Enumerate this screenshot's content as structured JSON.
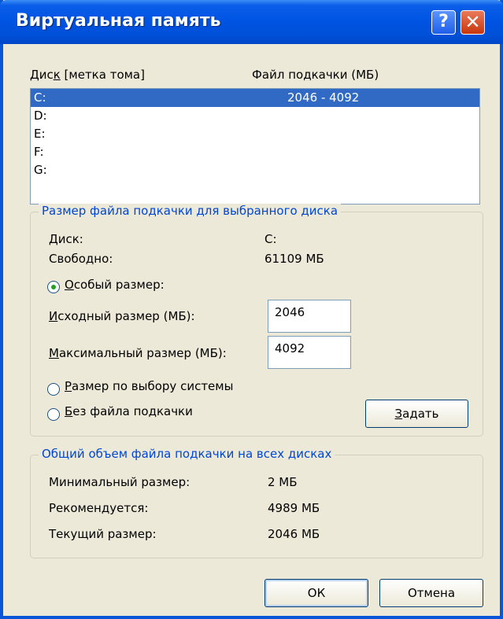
{
  "window": {
    "title": "Виртуальная память",
    "help_glyph": "?",
    "close_glyph": "✕"
  },
  "drives": {
    "header_disk_pre": "Дис",
    "header_disk_key": "к",
    "header_disk_post": " [метка тома]",
    "header_swap": "Файл подкачки (МБ)",
    "rows": [
      {
        "drive": "C:",
        "size": "2046 - 4092"
      },
      {
        "drive": "D:",
        "size": ""
      },
      {
        "drive": "E:",
        "size": ""
      },
      {
        "drive": "F:",
        "size": ""
      },
      {
        "drive": "G:",
        "size": ""
      }
    ]
  },
  "selected_drive": {
    "legend": "Размер файла подкачки для выбранного диска",
    "disk_label": "Диск:",
    "disk_value": "C:",
    "free_label": "Свободно:",
    "free_value": "61109 МБ",
    "custom_key": "О",
    "custom_rest": "собый размер:",
    "initial_key": "И",
    "initial_rest": "сходный размер (МБ):",
    "initial_value": "2046",
    "max_key": "М",
    "max_rest": "аксимальный размер (МБ):",
    "max_value": "4092",
    "system_key": "Р",
    "system_rest": "азмер по выбору системы",
    "none_key": "Б",
    "none_rest": "ез файла подкачки",
    "set_key": "З",
    "set_rest": "адать"
  },
  "totals": {
    "legend": "Общий объем файла подкачки на всех дисках",
    "min_label": "Минимальный размер:",
    "min_value": "2 МБ",
    "rec_label": "Рекомендуется:",
    "rec_value": "4989 МБ",
    "cur_label": "Текущий размер:",
    "cur_value": "2046 МБ"
  },
  "buttons": {
    "ok": "ОК",
    "cancel": "Отмена"
  },
  "selected_option": "custom"
}
